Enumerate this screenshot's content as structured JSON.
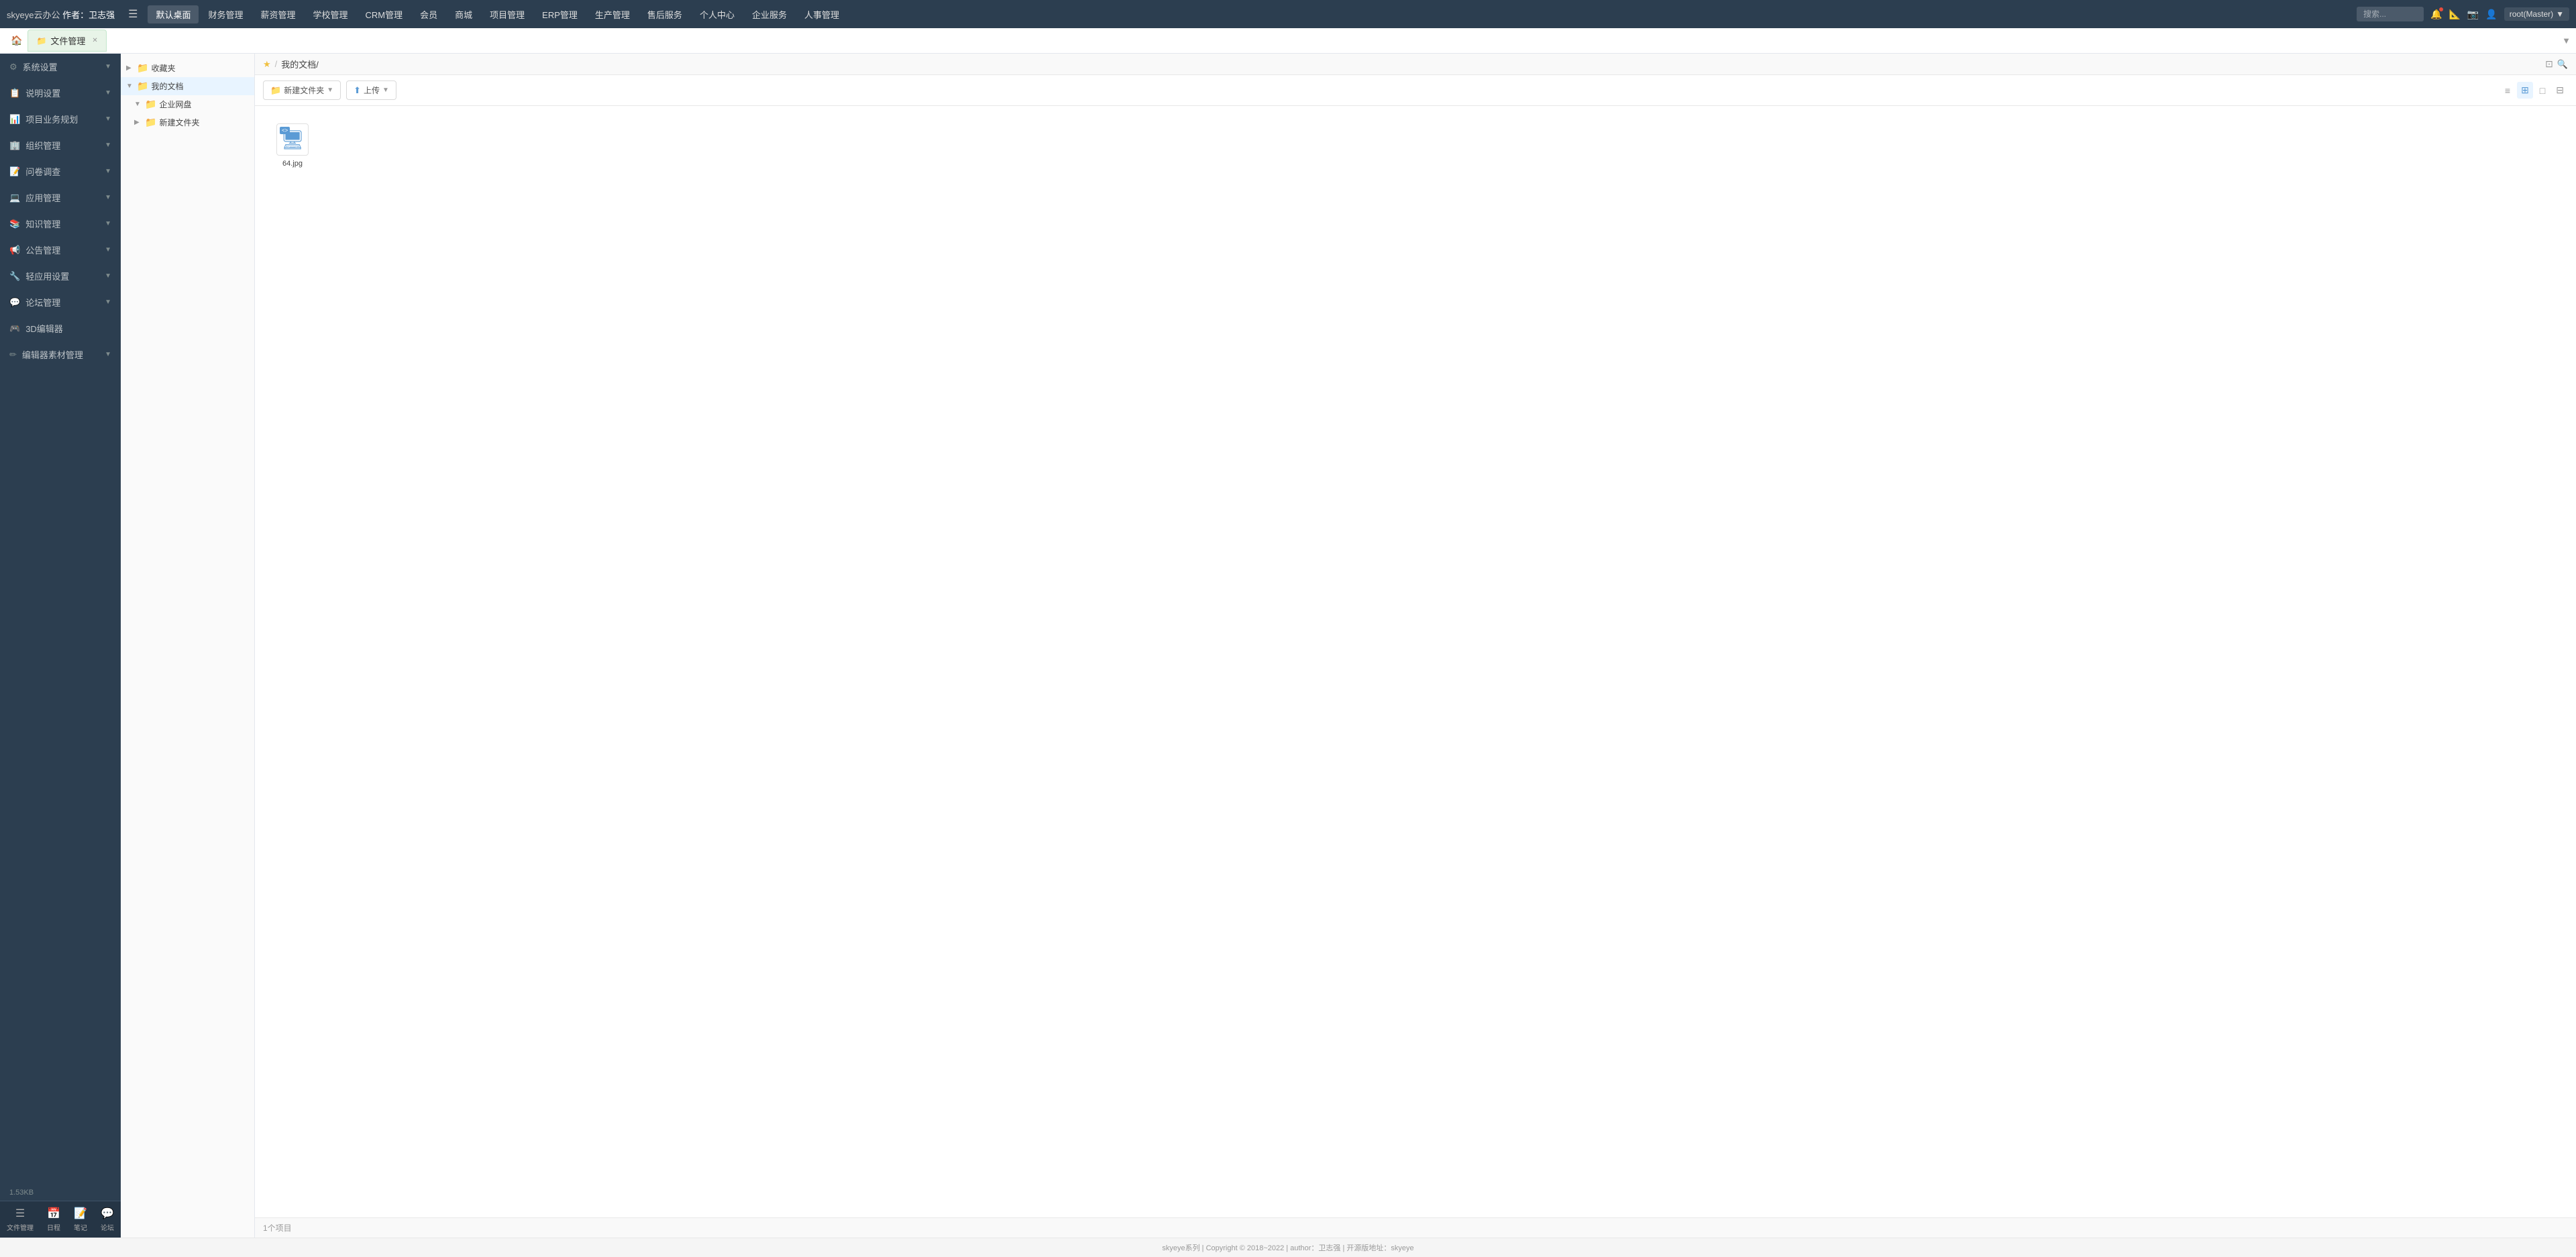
{
  "brand": {
    "name": "skyeye云办公",
    "author_label": "作者：",
    "author": "卫志强"
  },
  "top_nav": {
    "menu_icon": "☰",
    "items": [
      {
        "label": "默认桌面",
        "active": true
      },
      {
        "label": "财务管理",
        "active": false
      },
      {
        "label": "薪资管理",
        "active": false
      },
      {
        "label": "学校管理",
        "active": false
      },
      {
        "label": "CRM管理",
        "active": false
      },
      {
        "label": "会员",
        "active": false
      },
      {
        "label": "商城",
        "active": false
      },
      {
        "label": "项目管理",
        "active": false
      },
      {
        "label": "ERP管理",
        "active": false
      },
      {
        "label": "生产管理",
        "active": false
      },
      {
        "label": "售后服务",
        "active": false
      },
      {
        "label": "个人中心",
        "active": false
      },
      {
        "label": "企业服务",
        "active": false
      },
      {
        "label": "人事管理",
        "active": false
      }
    ],
    "search_placeholder": "搜索...",
    "user_label": "root(Master)",
    "user_dropdown": "▼"
  },
  "tab_bar": {
    "home_icon": "🏠",
    "tabs": [
      {
        "label": "文件管理",
        "icon": "📁",
        "active": true,
        "closable": true
      }
    ],
    "expand_icon": "▼"
  },
  "sidebar": {
    "items": [
      {
        "icon": "⚙",
        "label": "系统设置",
        "has_children": true
      },
      {
        "icon": "📋",
        "label": "说明设置",
        "has_children": true
      },
      {
        "icon": "📊",
        "label": "项目业务规划",
        "has_children": true
      },
      {
        "icon": "🏢",
        "label": "组织管理",
        "has_children": true
      },
      {
        "icon": "📝",
        "label": "问卷调查",
        "has_children": true
      },
      {
        "icon": "💻",
        "label": "应用管理",
        "has_children": true
      },
      {
        "icon": "📚",
        "label": "知识管理",
        "has_children": true
      },
      {
        "icon": "📢",
        "label": "公告管理",
        "has_children": true
      },
      {
        "icon": "🔧",
        "label": "轻应用设置",
        "has_children": true
      },
      {
        "icon": "💬",
        "label": "论坛管理",
        "has_children": true
      },
      {
        "icon": "🎮",
        "label": "3D编辑器",
        "has_children": false
      },
      {
        "icon": "✏",
        "label": "编辑器素材管理",
        "has_children": true
      }
    ],
    "bottom_nav": [
      {
        "icon": "☰",
        "label": "文件管理"
      },
      {
        "icon": "📅",
        "label": "日程"
      },
      {
        "icon": "📝",
        "label": "笔记"
      },
      {
        "icon": "💬",
        "label": "论坛"
      }
    ],
    "file_size": "1.53KB"
  },
  "file_tree": {
    "items": [
      {
        "label": "收藏夹",
        "level": 0,
        "expanded": false,
        "icon_color": "yellow"
      },
      {
        "label": "我的文档",
        "level": 0,
        "expanded": true,
        "icon_color": "yellow",
        "active": true
      },
      {
        "label": "企业网盘",
        "level": 1,
        "expanded": false,
        "icon_color": "blue"
      },
      {
        "label": "新建文件夹",
        "level": 1,
        "expanded": false,
        "icon_color": "green"
      }
    ]
  },
  "breadcrumb": {
    "star_icon": "★",
    "separator": "/",
    "path": "我的文档/",
    "expand_icon": "⊡",
    "search_icon": "🔍"
  },
  "toolbar": {
    "new_folder_label": "新建文件夹",
    "new_folder_drop": "▼",
    "upload_label": "上传",
    "upload_drop": "▼",
    "view_icons": [
      "≡",
      "⊞",
      "□□",
      "⊟"
    ]
  },
  "file_grid": {
    "files": [
      {
        "name": "64.jpg",
        "type": "image",
        "icon": "🖥",
        "code_badge": "<>"
      }
    ]
  },
  "status_bar": {
    "count_label": "1个项目"
  },
  "footer": {
    "text": "skyeye系列 | Copyright © 2018~2022 | author：卫志强 | 开源版地址：skyeye"
  }
}
